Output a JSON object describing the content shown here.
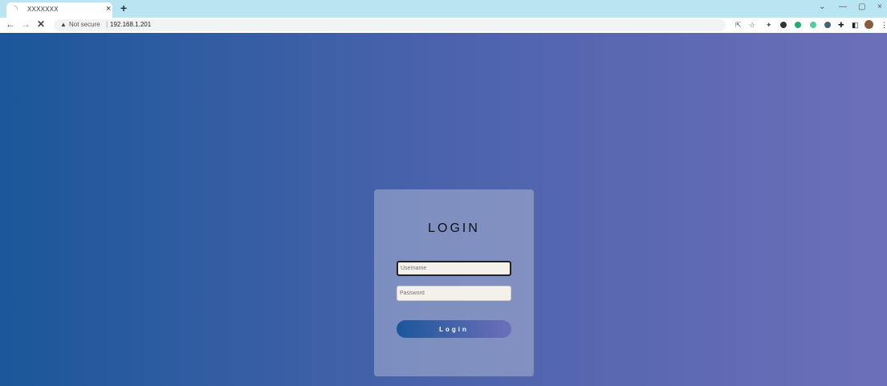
{
  "browser": {
    "tab_title": "XXXXXXX",
    "tab_close": "×",
    "new_tab": "+",
    "win_controls": [
      "⌄",
      "—",
      "▢",
      "×"
    ],
    "nav": {
      "back": "←",
      "forward": "→",
      "stop": "✕"
    },
    "security_label": "Not secure",
    "separator": "|",
    "url": "192.168.1.201",
    "toolbar_icons": [
      "share-icon",
      "star-icon",
      "extension-icon",
      "extension-icon",
      "extension-icon",
      "extension-icon",
      "extension-icon",
      "puzzle-icon",
      "sidepanel-icon",
      "avatar",
      "menu-icon"
    ]
  },
  "login": {
    "title": "LOGIN",
    "username_placeholder": "Username",
    "password_placeholder": "Password",
    "button_label": "Login"
  },
  "colors": {
    "gradient_start": "#1b579a",
    "gradient_mid": "#4b63ac",
    "gradient_end": "#6d6fb9",
    "tabstrip": "#b9e4f1"
  }
}
